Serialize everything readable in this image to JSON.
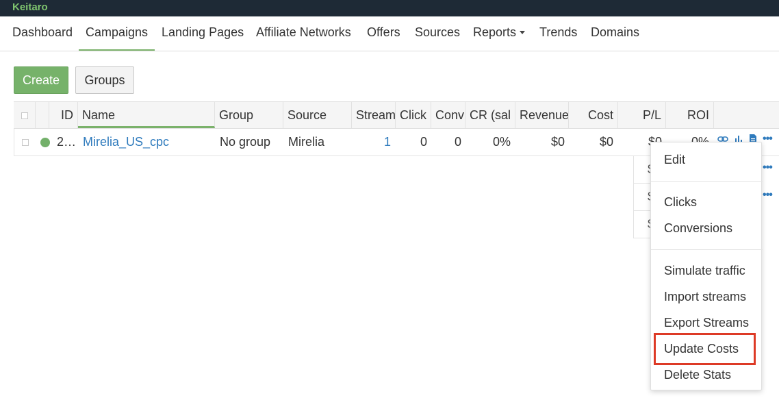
{
  "app": {
    "brand": "Keitaro"
  },
  "nav": {
    "items": [
      {
        "label": "Dashboard"
      },
      {
        "label": "Campaigns"
      },
      {
        "label": "Landing Pages"
      },
      {
        "label": "Affiliate Networks"
      },
      {
        "label": "Offers"
      },
      {
        "label": "Sources"
      },
      {
        "label": "Reports"
      },
      {
        "label": "Trends"
      },
      {
        "label": "Domains"
      }
    ],
    "active": "Campaigns"
  },
  "toolbar": {
    "create_label": "Create",
    "groups_label": "Groups"
  },
  "table": {
    "headers": {
      "id": "ID",
      "name": "Name",
      "group": "Group",
      "source": "Source",
      "streams": "Stream",
      "clicks": "Click",
      "conversions": "Conv",
      "cr": "CR (sal",
      "revenue": "Revenue",
      "cost": "Cost",
      "pl": "P/L",
      "roi": "ROI"
    },
    "rows": [
      {
        "status": "active",
        "id": "2…",
        "name": "Mirelia_US_cpc",
        "group": "No group",
        "source": "Mirelia",
        "streams": "1",
        "clicks": "0",
        "conversions": "0",
        "cr": "0%",
        "revenue": "$0",
        "cost": "$0",
        "pl": "$0",
        "roi": "0%"
      }
    ],
    "hidden_rows_pl": [
      "$",
      "$",
      "$"
    ]
  },
  "row_actions": {
    "icons": [
      "link-icon",
      "chart-icon",
      "report-icon"
    ],
    "more": "•••"
  },
  "context_menu": {
    "items": {
      "edit": "Edit",
      "clicks": "Clicks",
      "conversions": "Conversions",
      "simulate": "Simulate traffic",
      "import": "Import streams",
      "export": "Export Streams",
      "update_costs": "Update Costs",
      "delete_stats": "Delete Stats"
    },
    "highlighted": "Update Costs",
    "highlight_color": "#dd3a26"
  },
  "colors": {
    "brand": "#7fc46f",
    "accent": "#76b26a",
    "link": "#2f7bbd",
    "topbar": "#1e2a36"
  }
}
